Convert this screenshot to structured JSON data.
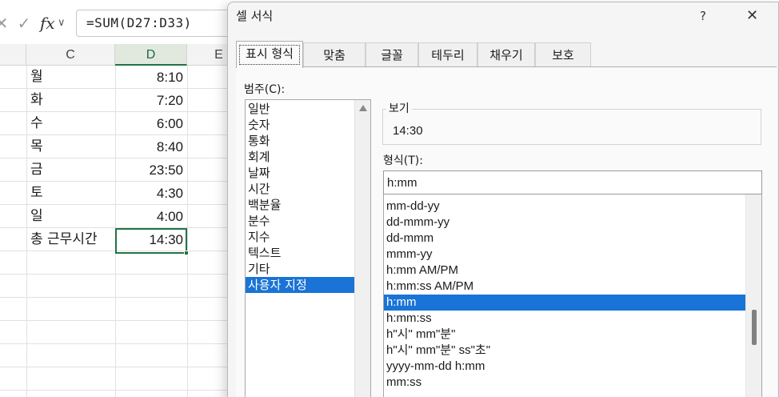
{
  "formula_bar": {
    "cancel_icon": "close-icon",
    "enter_icon": "check-icon",
    "fx_label": "fx",
    "formula": "=SUM(D27:D33)"
  },
  "columns": [
    "C",
    "D",
    "E"
  ],
  "rows": [
    {
      "day": "월",
      "time": "8:10"
    },
    {
      "day": "화",
      "time": "7:20"
    },
    {
      "day": "수",
      "time": "6:00"
    },
    {
      "day": "목",
      "time": "8:40"
    },
    {
      "day": "금",
      "time": "23:50"
    },
    {
      "day": "토",
      "time": "4:30"
    },
    {
      "day": "일",
      "time": "4:00"
    },
    {
      "day": "총 근무시간",
      "time": "14:30"
    }
  ],
  "dialog": {
    "title": "셀 서식",
    "help": "?",
    "close": "✕",
    "tabs": [
      "표시 형식",
      "맞춤",
      "글꼴",
      "테두리",
      "채우기",
      "보호"
    ],
    "active_tab": "표시 형식",
    "category_label": "범주(C):",
    "categories": [
      "일반",
      "숫자",
      "통화",
      "회계",
      "날짜",
      "시간",
      "백분율",
      "분수",
      "지수",
      "텍스트",
      "기타",
      "사용자 지정"
    ],
    "selected_category": "사용자 지정",
    "preview_label": "보기",
    "preview_value": "14:30",
    "type_label": "형식(T):",
    "type_value": "h:mm",
    "format_list": [
      "mm-dd-yy",
      "dd-mmm-yy",
      "dd-mmm",
      "mmm-yy",
      "h:mm AM/PM",
      "h:mm:ss AM/PM",
      "h:mm",
      "h:mm:ss",
      "h\"시\" mm\"분\"",
      "h\"시\" mm\"분\" ss\"초\"",
      "yyyy-mm-dd h:mm",
      "mm:ss"
    ],
    "selected_format": "h:mm"
  }
}
